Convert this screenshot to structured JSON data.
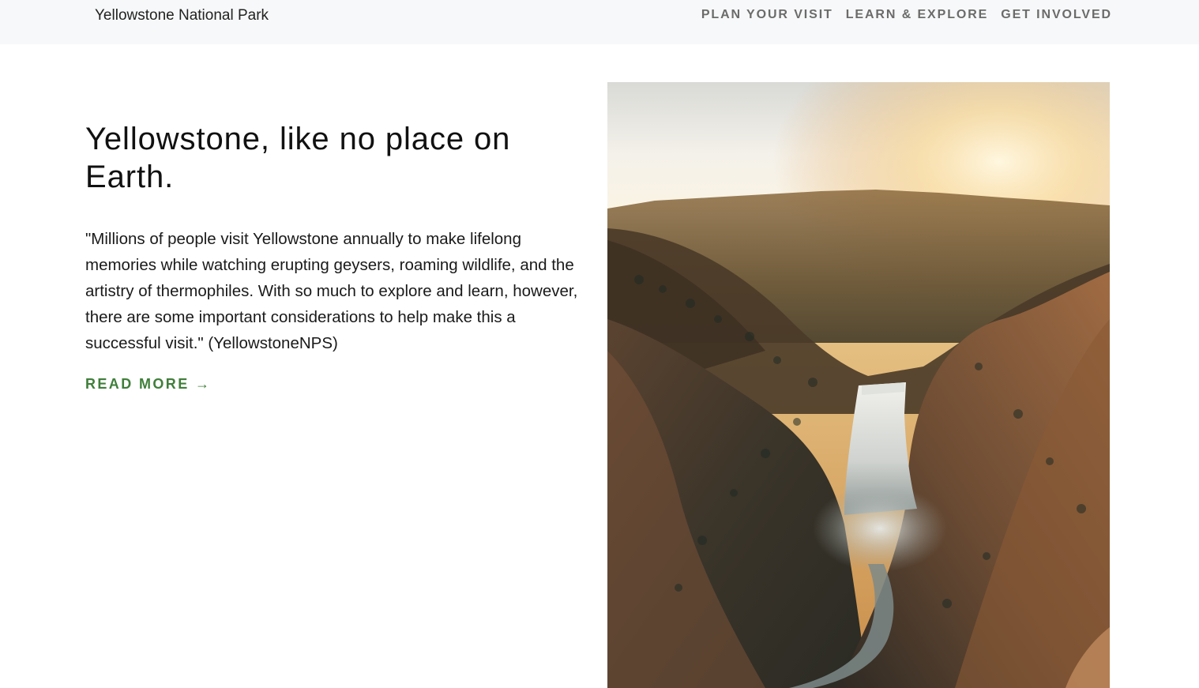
{
  "nav": {
    "brand": "Yellowstone National Park",
    "links": [
      {
        "label": "PLAN YOUR VISIT"
      },
      {
        "label": "LEARN & EXPLORE"
      },
      {
        "label": "GET INVOLVED"
      }
    ]
  },
  "hero": {
    "title": "Yellowstone, like no place on Earth.",
    "quote": "\"Millions of people visit Yellowstone annually to make lifelong memories while watching erupting geysers, roaming wildlife, and the artistry of thermophiles. With so much to explore and learn, however, there are some important considerations to help make this a successful visit.\" (YellowstoneNPS)",
    "cta": "READ MORE →"
  },
  "colors": {
    "nav_background": "#f7f8f9",
    "nav_link": "#6b6b6b",
    "accent_green": "#3f7f3a"
  }
}
